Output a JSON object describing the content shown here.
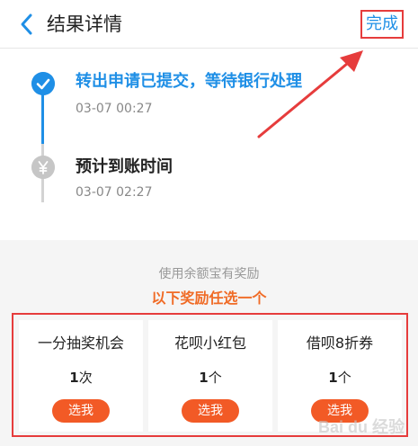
{
  "header": {
    "title": "结果详情",
    "done_label": "完成"
  },
  "timeline": {
    "steps": [
      {
        "title": "转出申请已提交，等待银行处理",
        "time": "03-07 00:27",
        "status": "done"
      },
      {
        "title": "预计到账时间",
        "time": "03-07 02:27",
        "status": "pending"
      }
    ]
  },
  "rewards": {
    "subtitle": "使用余额宝有奖励",
    "headline": "以下奖励任选一个",
    "cards": [
      {
        "name": "一分抽奖机会",
        "count": "1",
        "unit": "次",
        "button": "选我"
      },
      {
        "name": "花呗小红包",
        "count": "1",
        "unit": "个",
        "button": "选我"
      },
      {
        "name": "借呗8折券",
        "count": "1",
        "unit": "个",
        "button": "选我"
      }
    ]
  },
  "watermark": {
    "text": "Bai du 经验"
  },
  "colors": {
    "accent_blue": "#1f8fe6",
    "annotation_red": "#e63c3c",
    "reward_orange": "#f06b26",
    "button_orange": "#f25a26"
  },
  "icons": [
    "back-chevron-icon",
    "check-circle-icon",
    "yen-circle-icon",
    "annotation-arrow"
  ]
}
